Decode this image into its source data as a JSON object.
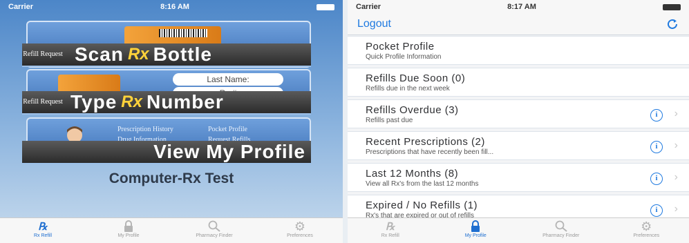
{
  "left": {
    "status": {
      "carrier": "Carrier",
      "time": "8:16 AM"
    },
    "scan": {
      "small": "Refill Request",
      "word1": "Scan",
      "rx": "Rx",
      "word2": "Bottle"
    },
    "type": {
      "small": "Refill Request",
      "word1": "Type",
      "rx": "Rx",
      "word2": "Number",
      "field1": "Last Name:",
      "field2": "Rx #"
    },
    "profile": {
      "label": "View My Profile",
      "links": [
        "Prescription History",
        "Pocket Profile",
        "Drug Information",
        "Request Refills"
      ]
    },
    "app_title": "Computer-Rx Test",
    "tabs": [
      {
        "icon": "rx-icon",
        "label": "Rx Refill",
        "active": true
      },
      {
        "icon": "lock-icon",
        "label": "My Profile",
        "active": false
      },
      {
        "icon": "search-icon",
        "label": "Pharmacy Finder",
        "active": false
      },
      {
        "icon": "gear-icon",
        "label": "Preferences",
        "active": false
      }
    ]
  },
  "right": {
    "status": {
      "carrier": "Carrier",
      "time": "8:17 AM"
    },
    "nav": {
      "logout": "Logout"
    },
    "rows": [
      {
        "title": "Pocket Profile",
        "subtitle": "Quick Profile Information",
        "info": false
      },
      {
        "title": "Refills Due Soon (0)",
        "subtitle": "Refills due in the next week",
        "info": false
      },
      {
        "title": "Refills Overdue (3)",
        "subtitle": "Refills past due",
        "info": true
      },
      {
        "title": "Recent Prescriptions (2)",
        "subtitle": "Prescriptions that have recently been fill...",
        "info": true
      },
      {
        "title": "Last 12 Months (8)",
        "subtitle": "View all Rx's from the last 12 months",
        "info": true
      },
      {
        "title": "Expired / No Refills (1)",
        "subtitle": "Rx's that are expired or out of refills",
        "info": true
      }
    ],
    "tabs": [
      {
        "icon": "rx-icon",
        "label": "Rx Refill",
        "active": false
      },
      {
        "icon": "lock-icon",
        "label": "My Profile",
        "active": true
      },
      {
        "icon": "search-icon",
        "label": "Pharmacy Finder",
        "active": false
      },
      {
        "icon": "gear-icon",
        "label": "Preferences",
        "active": false
      }
    ]
  }
}
